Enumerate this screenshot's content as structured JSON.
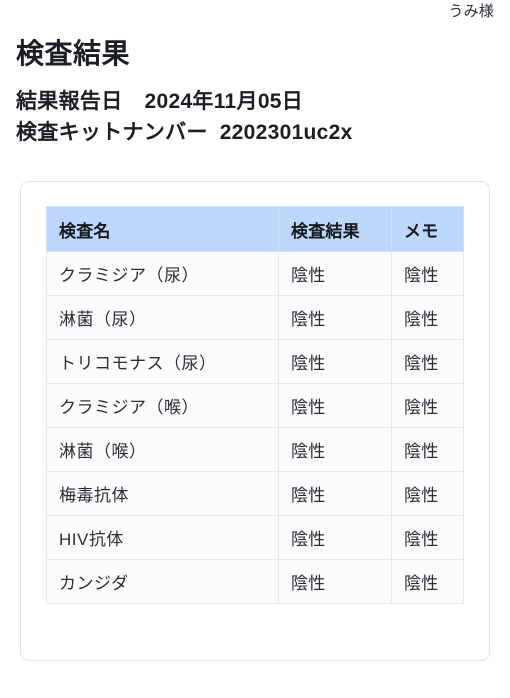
{
  "user": {
    "name": "うみ様"
  },
  "header": {
    "title": "検査結果",
    "report_date_label": "結果報告日",
    "report_date_value": "2024年11月05日",
    "kit_number_label": "検査キットナンバー",
    "kit_number_value": "2202301uc2x"
  },
  "colors": {
    "table_header_bg": "#bdd7fb",
    "card_border": "#e2e4e8",
    "cell_border": "#e6e8ec",
    "text": "#1b1f23",
    "page_bg": "#ffffff"
  },
  "table": {
    "columns": [
      "検査名",
      "検査結果",
      "メモ"
    ],
    "rows": [
      [
        "クラミジア（尿）",
        "陰性",
        "陰性"
      ],
      [
        "淋菌（尿）",
        "陰性",
        "陰性"
      ],
      [
        "トリコモナス（尿）",
        "陰性",
        "陰性"
      ],
      [
        "クラミジア（喉）",
        "陰性",
        "陰性"
      ],
      [
        "淋菌（喉）",
        "陰性",
        "陰性"
      ],
      [
        "梅毒抗体",
        "陰性",
        "陰性"
      ],
      [
        "HIV抗体",
        "陰性",
        "陰性"
      ],
      [
        "カンジダ",
        "陰性",
        "陰性"
      ]
    ]
  }
}
